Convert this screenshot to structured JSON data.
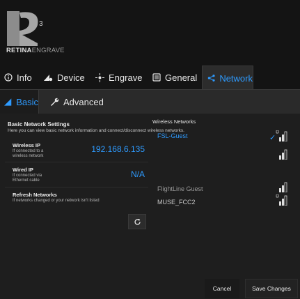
{
  "logo": {
    "superscript": "3",
    "brand_bold": "RETINA",
    "brand_light": "ENGRAVE"
  },
  "main_tabs": [
    {
      "label": "Info",
      "icon": "info-icon"
    },
    {
      "label": "Device",
      "icon": "device-icon"
    },
    {
      "label": "Engrave",
      "icon": "engrave-icon"
    },
    {
      "label": "General",
      "icon": "general-icon"
    },
    {
      "label": "Network",
      "icon": "share-icon",
      "active": true
    }
  ],
  "sub_tabs": [
    {
      "label": "Basic",
      "icon": "basic-icon",
      "active": true
    },
    {
      "label": "Advanced",
      "icon": "wrench-icon"
    }
  ],
  "section": {
    "title": "Basic Network Settings",
    "description": "Here you can view basic network information and connect/disconnect wireless networks."
  },
  "wireless_ip": {
    "title": "Wireless IP",
    "sub1": "If connected to a",
    "sub2": "wireless network",
    "value": "192.168.6.135"
  },
  "wired_ip": {
    "title": "Wired IP",
    "sub1": "If connected via",
    "sub2": "Ethernet cable",
    "value": "N/A"
  },
  "refresh": {
    "title": "Refresh Networks",
    "sub": "If networks changed or your network isn't listed"
  },
  "wireless_networks": {
    "title": "Wireless Networks",
    "items": [
      {
        "name": "FSL-Guest",
        "connected": true,
        "secured": true
      },
      {
        "name": "",
        "connected": false,
        "secured": false
      },
      {
        "name": "FlightLine Guest",
        "connected": false,
        "secured": false
      },
      {
        "name": "MUSE_FCC2",
        "connected": false,
        "secured": true
      }
    ]
  },
  "footer": {
    "cancel": "Cancel",
    "save": "Save Changes"
  },
  "colors": {
    "accent": "#2e9bff",
    "background": "#141414",
    "panel": "#1e1e1e"
  }
}
